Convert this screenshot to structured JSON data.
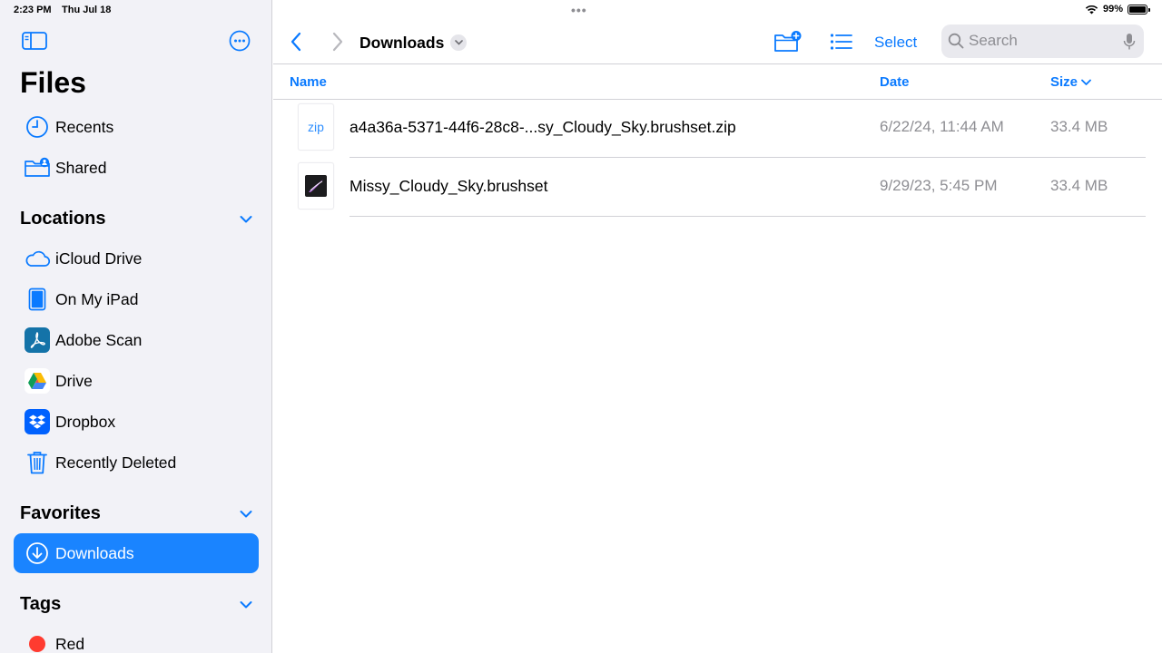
{
  "status": {
    "time": "2:23 PM",
    "date": "Thu Jul 18",
    "battery": "99%"
  },
  "sidebar": {
    "title": "Files",
    "top_items": [
      {
        "label": "Recents",
        "icon": "clock-icon"
      },
      {
        "label": "Shared",
        "icon": "shared-folder-icon"
      }
    ],
    "locations": {
      "header": "Locations",
      "items": [
        {
          "label": "iCloud Drive",
          "icon": "icloud-icon"
        },
        {
          "label": "On My iPad",
          "icon": "ipad-icon"
        },
        {
          "label": "Adobe Scan",
          "icon": "adobe-scan-icon"
        },
        {
          "label": "Drive",
          "icon": "google-drive-icon"
        },
        {
          "label": "Dropbox",
          "icon": "dropbox-icon"
        },
        {
          "label": "Recently Deleted",
          "icon": "trash-icon"
        }
      ]
    },
    "favorites": {
      "header": "Favorites",
      "items": [
        {
          "label": "Downloads",
          "icon": "download-icon",
          "active": true
        }
      ]
    },
    "tags": {
      "header": "Tags",
      "items": [
        {
          "label": "Red",
          "color": "#ff3b30"
        }
      ]
    }
  },
  "toolbar": {
    "folder_name": "Downloads",
    "select_label": "Select",
    "search_placeholder": "Search"
  },
  "columns": {
    "name": "Name",
    "date": "Date",
    "size": "Size"
  },
  "files": [
    {
      "name": "a4a36a-5371-44f6-28c8-...sy_Cloudy_Sky.brushset.zip",
      "thumb_label": "zip",
      "date": "6/22/24, 11:44 AM",
      "size": "33.4 MB"
    },
    {
      "name": "Missy_Cloudy_Sky.brushset",
      "date": "9/29/23, 5:45 PM",
      "size": "33.4 MB"
    }
  ],
  "colors": {
    "accent": "#0a7aff",
    "active_bg": "#1a84ff",
    "sidebar_bg": "#f2f2f7"
  }
}
